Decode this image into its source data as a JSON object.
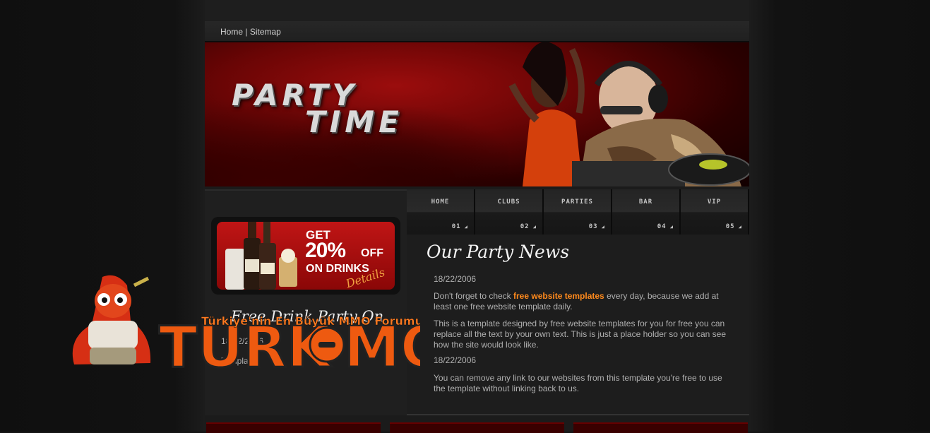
{
  "top_links": {
    "home": "Home",
    "separator": "|",
    "sitemap": "Sitemap"
  },
  "banner": {
    "line1": "PARTY",
    "line2": "TIME"
  },
  "nav": [
    {
      "label": "HOME",
      "num": "01"
    },
    {
      "label": "CLUBS",
      "num": "02"
    },
    {
      "label": "PARTIES",
      "num": "03"
    },
    {
      "label": "BAR",
      "num": "04"
    },
    {
      "label": "VIP",
      "num": "05"
    }
  ],
  "promo": {
    "get": "GET",
    "percent": "20%",
    "off": "OFF",
    "on_drinks": "ON DRINKS",
    "details": "Details"
  },
  "left": {
    "title": "Free Drink Party On",
    "date": "18/22/2006",
    "text": "Template"
  },
  "news": {
    "title": "Our Party News",
    "date1": "18/22/2006",
    "p1_before": "Don't forget to check ",
    "p1_link": "free website templates",
    "p1_after": " every day, because we add at least one free website template daily.",
    "p2": "This is a template designed by free website templates for you for free you can replace all the text by your own text. This is just a place holder so you can see how the site would look like.",
    "date2": "18/22/2006",
    "p3": "You can remove any link to our websites from this template you're free to use the template without linking back to us."
  },
  "watermark": {
    "slogan": "Türkiye'nin En Büyük MMO Forumu",
    "brand_left": "TURK",
    "brand_right": "MO"
  },
  "colors": {
    "accent": "#ff8a1c",
    "banner_red": "#9b0d0d"
  }
}
